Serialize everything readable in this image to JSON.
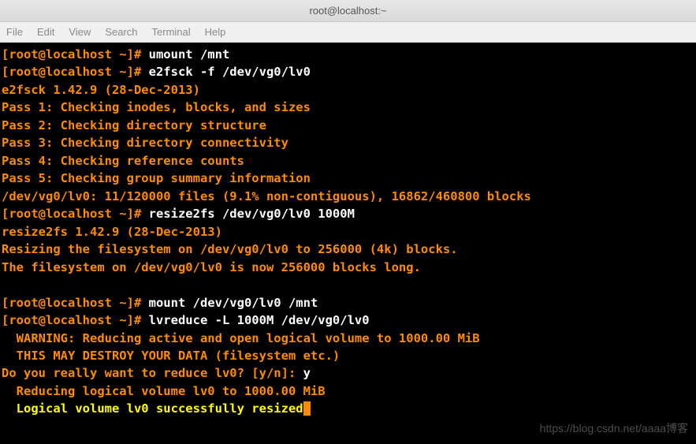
{
  "titlebar": {
    "title": "root@localhost:~"
  },
  "menubar": {
    "file": "File",
    "edit": "Edit",
    "view": "View",
    "search": "Search",
    "terminal": "Terminal",
    "help": "Help"
  },
  "lines": {
    "l1_prompt": "[root@localhost ~]# ",
    "l1_cmd": "umount /mnt",
    "l2_prompt": "[root@localhost ~]# ",
    "l2_cmd": "e2fsck -f /dev/vg0/lv0",
    "l3": "e2fsck 1.42.9 (28-Dec-2013)",
    "l4": "Pass 1: Checking inodes, blocks, and sizes",
    "l5": "Pass 2: Checking directory structure",
    "l6": "Pass 3: Checking directory connectivity",
    "l7": "Pass 4: Checking reference counts",
    "l8": "Pass 5: Checking group summary information",
    "l9": "/dev/vg0/lv0: 11/120000 files (9.1% non-contiguous), 16862/460800 blocks",
    "l10_prompt": "[root@localhost ~]# ",
    "l10_cmd": "resize2fs /dev/vg0/lv0 1000M",
    "l11": "resize2fs 1.42.9 (28-Dec-2013)",
    "l12": "Resizing the filesystem on /dev/vg0/lv0 to 256000 (4k) blocks.",
    "l13": "The filesystem on /dev/vg0/lv0 is now 256000 blocks long.",
    "l14": "",
    "l15_prompt": "[root@localhost ~]# ",
    "l15_cmd": "mount /dev/vg0/lv0 /mnt",
    "l16_prompt": "[root@localhost ~]# ",
    "l16_cmd": "lvreduce -L 1000M /dev/vg0/lv0",
    "l17": "  WARNING: Reducing active and open logical volume to 1000.00 MiB",
    "l18": "  THIS MAY DESTROY YOUR DATA (filesystem etc.)",
    "l19a": "Do you really want to reduce lv0? [y/n]: ",
    "l19b": "y",
    "l20": "  Reducing logical volume lv0 to 1000.00 MiB",
    "l21": "  Logical volume lv0 successfully resized"
  },
  "watermark": "https://blog.csdn.net/aaaa博客"
}
